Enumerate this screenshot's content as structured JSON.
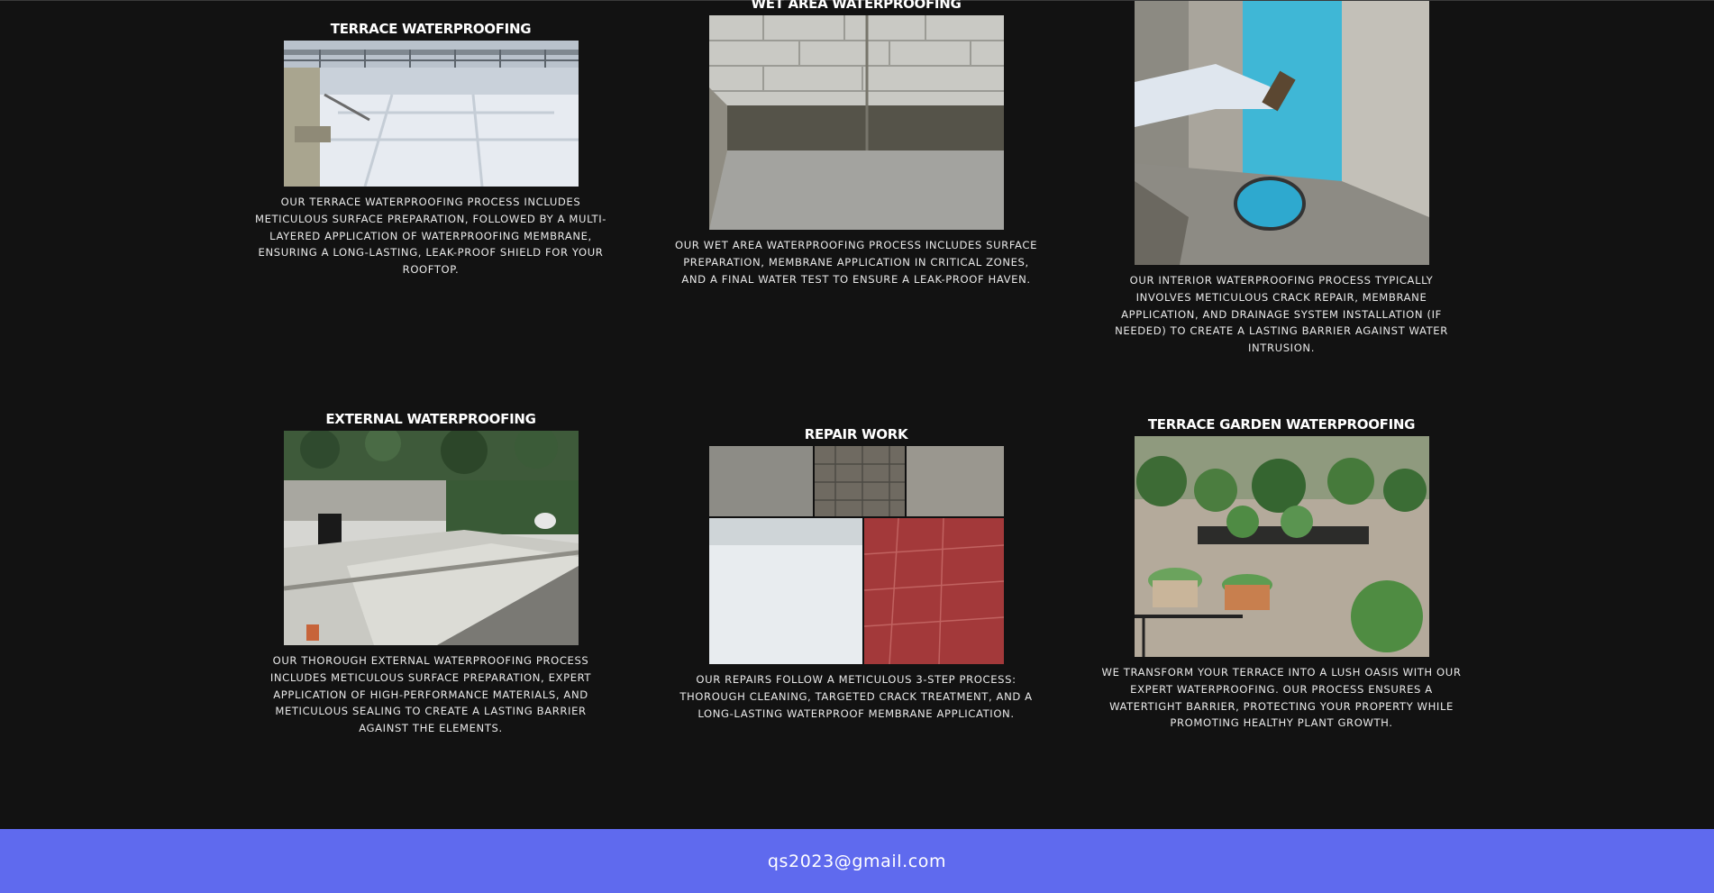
{
  "services": [
    {
      "title": "TERRACE WATERPROOFING",
      "description": "OUR TERRACE WATERPROOFING PROCESS INCLUDES METICULOUS SURFACE PREPARATION, FOLLOWED BY A MULTI-LAYERED APPLICATION OF WATERPROOFING MEMBRANE, ENSURING A LONG-LASTING, LEAK-PROOF SHIELD FOR YOUR ROOFTOP."
    },
    {
      "title": "WET AREA WATERPROOFING",
      "description": "OUR WET AREA WATERPROOFING PROCESS INCLUDES SURFACE PREPARATION, MEMBRANE APPLICATION IN CRITICAL ZONES, AND A FINAL WATER TEST TO ENSURE A LEAK-PROOF HAVEN."
    },
    {
      "title": "",
      "description": "OUR INTERIOR WATERPROOFING PROCESS TYPICALLY INVOLVES METICULOUS CRACK REPAIR, MEMBRANE APPLICATION, AND DRAINAGE SYSTEM INSTALLATION (IF NEEDED) TO CREATE A LASTING BARRIER AGAINST WATER INTRUSION."
    },
    {
      "title": "EXTERNAL WATERPROOFING",
      "description": "OUR THOROUGH EXTERNAL WATERPROOFING PROCESS INCLUDES METICULOUS SURFACE PREPARATION, EXPERT APPLICATION OF HIGH-PERFORMANCE MATERIALS, AND METICULOUS SEALING TO CREATE A LASTING BARRIER AGAINST THE ELEMENTS."
    },
    {
      "title": "REPAIR WORK",
      "description": "OUR REPAIRS FOLLOW A METICULOUS 3-STEP PROCESS: THOROUGH CLEANING, TARGETED CRACK TREATMENT, AND A LONG-LASTING WATERPROOF MEMBRANE APPLICATION."
    },
    {
      "title": "TERRACE GARDEN WATERPROOFING",
      "description": "WE TRANSFORM YOUR TERRACE INTO A LUSH OASIS WITH OUR EXPERT WATERPROOFING. OUR PROCESS ENSURES A WATERTIGHT BARRIER, PROTECTING YOUR PROPERTY WHILE PROMOTING HEALTHY PLANT GROWTH."
    }
  ],
  "footer": {
    "email": "qs2023@gmail.com"
  },
  "colors": {
    "background": "#121212",
    "footer": "#5f6aee",
    "text": "#ffffff"
  }
}
